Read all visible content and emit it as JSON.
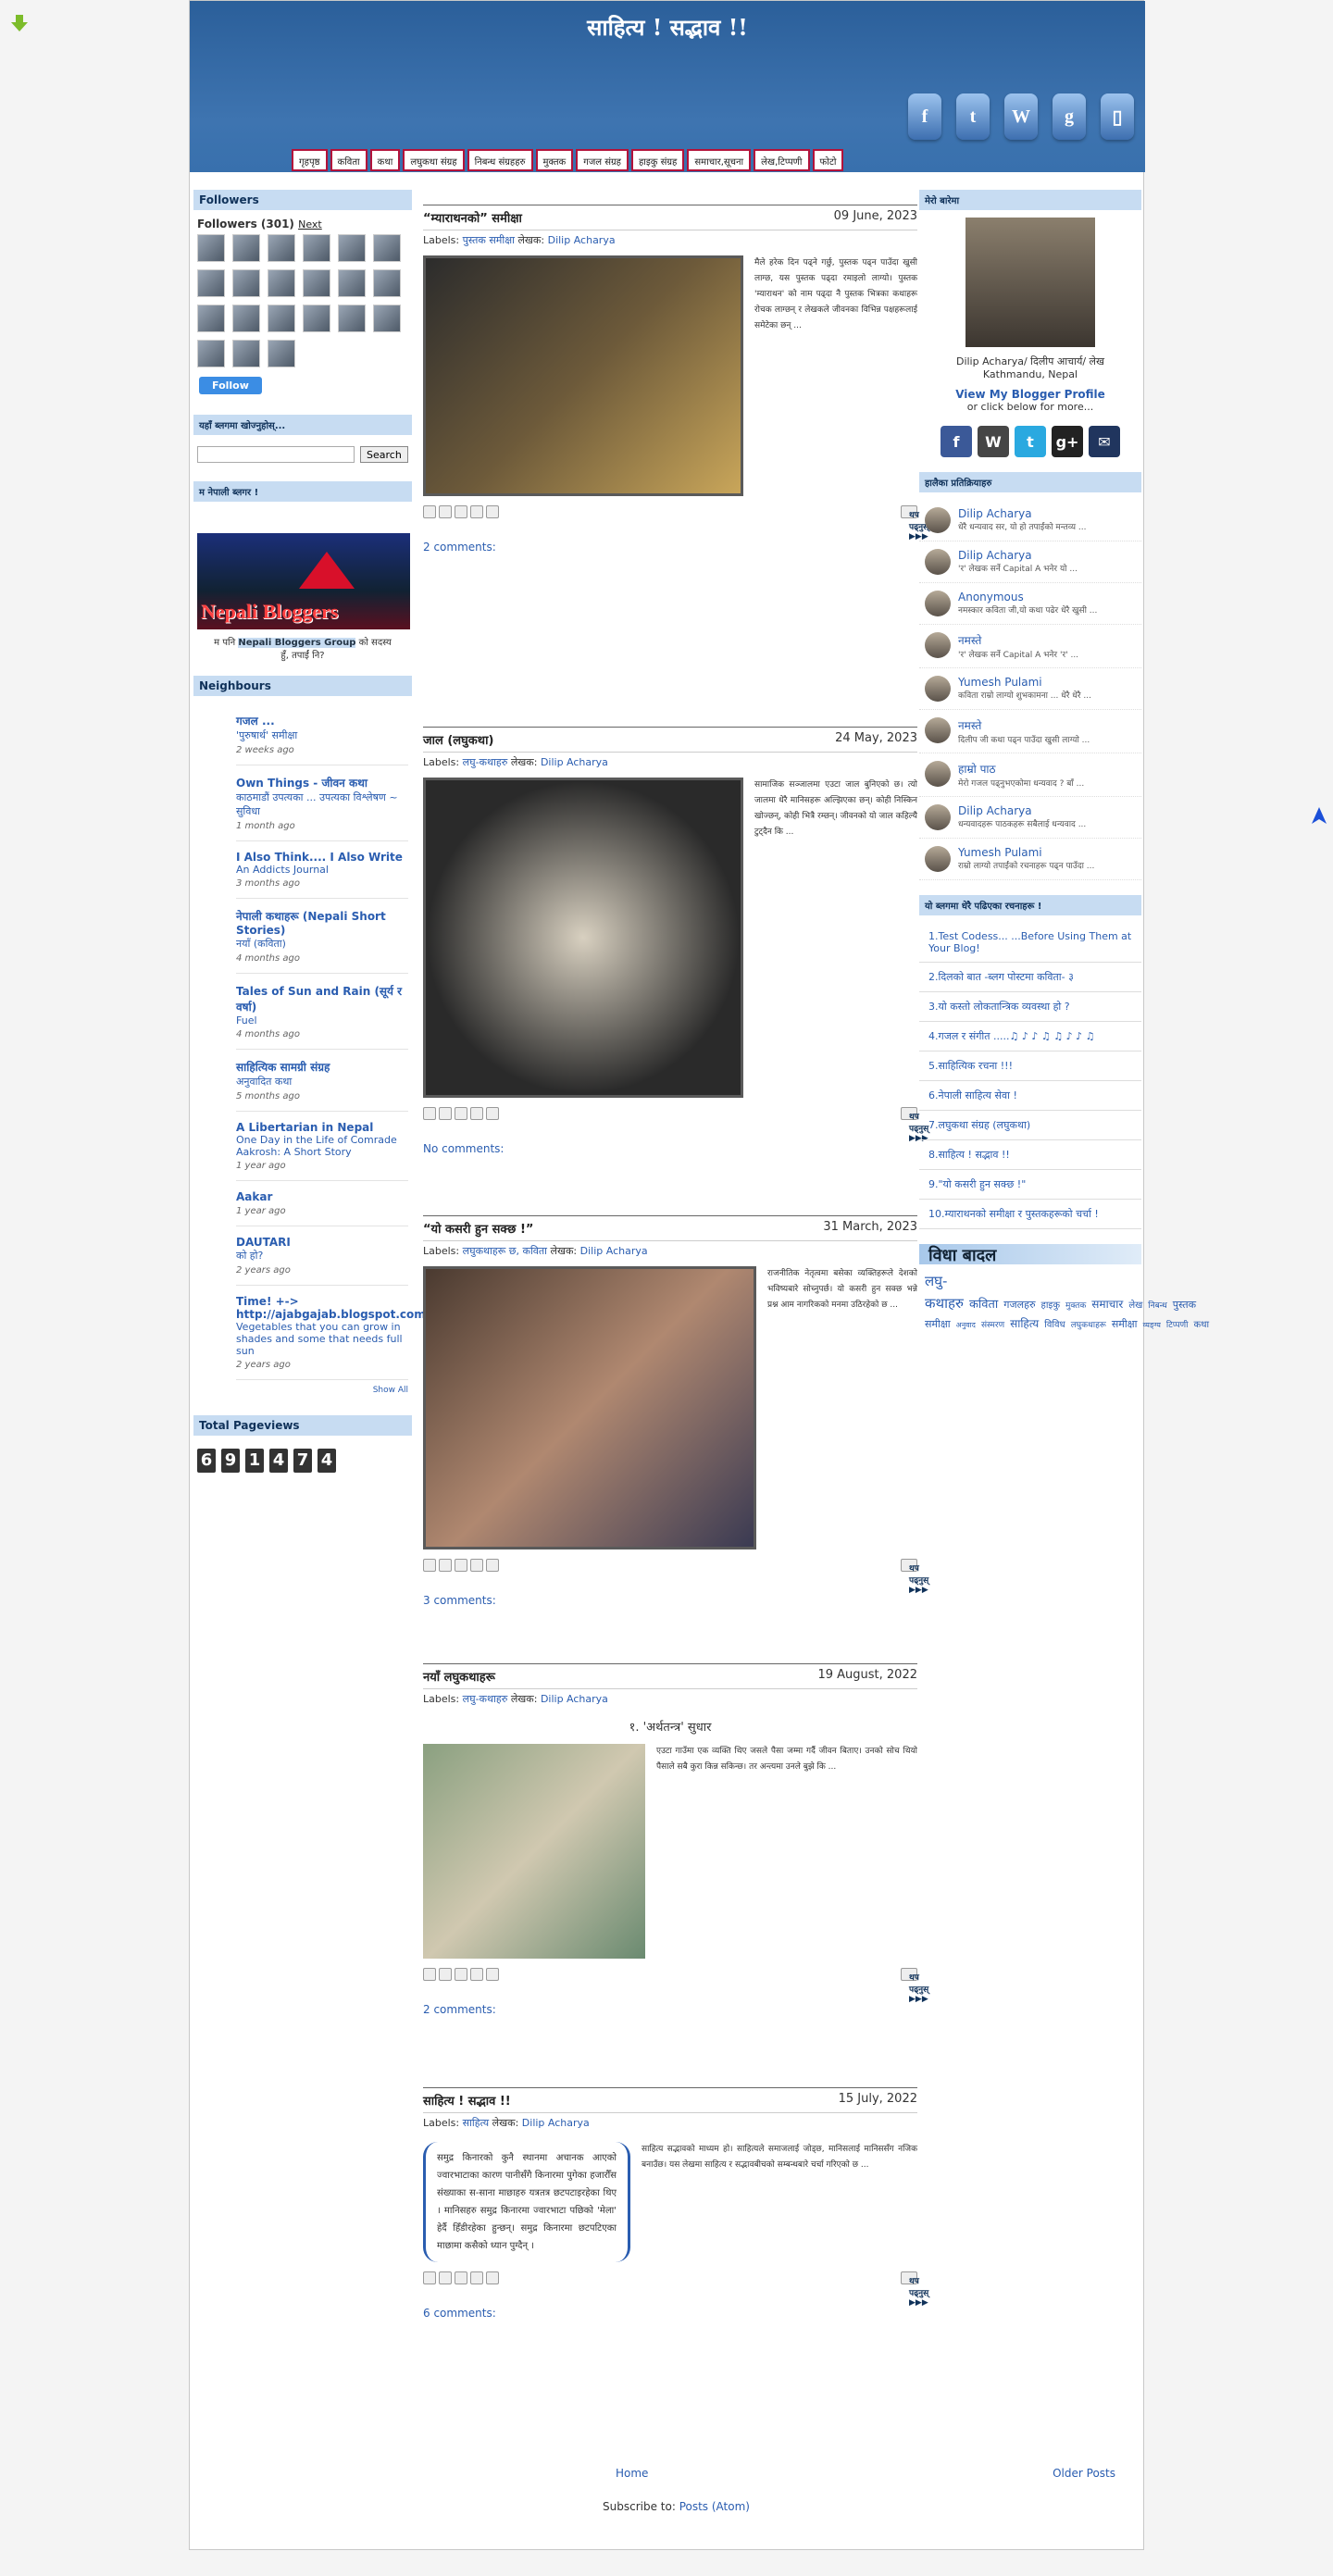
{
  "blog": {
    "title": "साहित्य ! सद्भाव !!"
  },
  "nav": [
    "गृहपृष्ठ",
    "कविता",
    "कथा",
    "लघुकथा संग्रह",
    "निबन्ध संग्रहहरु",
    "मुक्तक",
    "गजल संग्रह",
    "हाइकु संग्रह",
    "समाचार,सूचना",
    "लेख,टिप्पणी",
    "फोटो"
  ],
  "left": {
    "followers_title": "Followers",
    "followers_count": "Followers (301)",
    "followers_next": "Next",
    "follow_label": "Follow",
    "search_title": "यहाँ ब्लगमा खोज्नुहोस्...",
    "search_button": "Search",
    "nb_title": "म नेपाली ब्लगर !",
    "nb_banner_text": "Nepali Bloggers",
    "nb_caption_pre": "म पनि",
    "nb_caption_link": "Nepali Bloggers Group",
    "nb_caption_post": "को सदस्य हुँ, तपाईं नि?",
    "neighbours_title": "Neighbours",
    "neighbours": [
      {
        "title": "गजल ...",
        "sub": "'पुरुषार्थ' समीक्षा",
        "ago": "2 weeks ago"
      },
      {
        "title": "Own Things - जीवन कथा",
        "sub": "काठमाडौं उपत्यका ... उपत्यका विश्लेषण ~ सुविधा",
        "ago": "1 month ago"
      },
      {
        "title": "I Also Think.... I Also Write",
        "sub": "An Addicts Journal",
        "ago": "3 months ago"
      },
      {
        "title": "नेपाली कथाहरू (Nepali Short Stories)",
        "sub": "नयाँ (कविता)",
        "ago": "4 months ago"
      },
      {
        "title": "Tales of Sun and Rain (सूर्य र वर्षा)",
        "sub": "Fuel",
        "ago": "4 months ago"
      },
      {
        "title": "साहित्यिक सामग्री संग्रह",
        "sub": "अनुवादित कथा",
        "ago": "5 months ago"
      },
      {
        "title": "A Libertarian in Nepal",
        "sub": "One Day in the Life of Comrade Aakrosh: A Short Story",
        "ago": "1 year ago"
      },
      {
        "title": "Aakar",
        "sub": "",
        "ago": "1 year ago"
      },
      {
        "title": "DAUTARI",
        "sub": "को हो?",
        "ago": "2 years ago"
      },
      {
        "title": "Time! +-> http://ajabgajab.blogspot.com",
        "sub": "Vegetables that you can grow in shades and some that needs full sun",
        "ago": "2 years ago"
      }
    ],
    "show_all": "Show All",
    "pageviews_title": "Total Pageviews",
    "pageviews_digits": [
      "6",
      "9",
      "1",
      "4",
      "7",
      "4"
    ]
  },
  "posts": [
    {
      "title": "“म्याराथनको” समीक्षा",
      "date": "09 June, 2023",
      "labels_prefix": "Labels:",
      "label": "पुस्तक समीक्षा",
      "author_prefix": "लेखक:",
      "author": "Dilip Acharya",
      "text": "मैले हरेक दिन पढ्ने गर्छु, पुस्तक पढ्न पाउँदा खुसी लाग्छ, यस पुस्तक पढ्दा रमाइलो लाग्यो। पुस्तक 'म्याराथन' को नाम पढ्दा नै पुस्तक भित्रका कथाहरू रोचक लाग्छन् र लेखकले जीवनका विभिन्न पक्षहरूलाई समेटेका छन् ...",
      "more": "थप पढ्नुस् ▶▶▶",
      "comments": "2 comments:"
    },
    {
      "title": "जाल (लघुकथा)",
      "date": "24 May, 2023",
      "labels_prefix": "Labels:",
      "label": "लघु-कथाहरु",
      "author_prefix": "लेखक:",
      "author": "Dilip Acharya",
      "text": "सामाजिक सञ्जालमा एउटा जाल बुनिएको छ। त्यो जालमा धेरै मानिसहरू अल्झिएका छन्। कोही निस्किन खोज्छन्, कोही भित्रै रम्छन्। जीवनको यो जाल कहिल्यै टुट्दैन कि ...",
      "more": "थप पढ्नुस् ▶▶▶",
      "comments": "No comments:"
    },
    {
      "title": "“यो कसरी हुन सक्छ !”",
      "date": "31 March, 2023",
      "labels_prefix": "Labels:",
      "label": "लघुकथाहरू छ, कविता",
      "author_prefix": "लेखक:",
      "author": "Dilip Acharya",
      "text": "राजनीतिक नेतृत्वमा बसेका व्यक्तिहरूले देशको भविष्यबारे सोच्नुपर्छ। यो कसरी हुन सक्छ भन्ने प्रश्न आम नागरिकको मनमा उठिरहेको छ ...",
      "more": "थप पढ्नुस् ▶▶▶",
      "comments": "3 comments:"
    },
    {
      "title": "नयाँ लघुकथाहरू",
      "date": "19 August, 2022",
      "labels_prefix": "Labels:",
      "label": "लघु-कथाहरु",
      "author_prefix": "लेखक:",
      "author": "Dilip Acharya",
      "subtitle": "१. 'अर्थतन्त्र' सुधार",
      "text": "एउटा गाउँमा एक व्यक्ति थिए जसले पैसा जम्मा गर्दै जीवन बिताए। उनको सोच थियो पैसाले सबै कुरा किन्न सकिन्छ। तर अन्त्यमा उनले बुझे कि ...",
      "more": "थप पढ्नुस् ▶▶▶",
      "comments": "2 comments:"
    },
    {
      "title": "साहित्य ! सद्भाव !!",
      "date": "15 July, 2022",
      "labels_prefix": "Labels:",
      "label": "साहित्य",
      "author_prefix": "लेखक:",
      "author": "Dilip Acharya",
      "quote": "समुद्र किनारको कुनै स्थानमा अचानक आएको ज्वारभाटाका कारण पानीसँगै किनारमा पुगेका हजारौँस संख्याका स-साना माछाहरु यत्रतत्र छटपटाइरहेका थिए । मानिसहरु समुद्र किनारमा ज्वारभाटा पछिको 'मेला' हेर्दै हिँडीरहेका हुन्छन्। समुद्र किनारमा छटपटिएका माछामा कसैको ध्यान पुग्दैन् ।",
      "text": "साहित्य सद्भावको माध्यम हो। साहित्यले समाजलाई जोड्छ, मानिसलाई मानिससँग नजिक बनाउँछ। यस लेखमा साहित्य र सद्भावबीचको सम्बन्धबारे चर्चा गरिएको छ ...",
      "more": "थप पढ्नुस् ▶▶▶",
      "comments": "6 comments:"
    }
  ],
  "right": {
    "about_title": "मेरो बारेमा",
    "profile_name": "Dilip Acharya/ दिलीप आचार्य/ लेख",
    "profile_loc": "Kathmandu, Nepal",
    "profile_link": "View My Blogger Profile",
    "profile_sub": "or click below for more...",
    "recent_title": "हालैका प्रतिक्रियाहरु",
    "recent": [
      {
        "name": "Dilip Acharya",
        "text": "धेरै धन्यवाद सर, यो हो तपाईंको मन्तव्य ..."
      },
      {
        "name": "Dilip Acharya",
        "text": "'र' लेखक सर्ने Capital A भनेर यो ..."
      },
      {
        "name": "Anonymous",
        "text": "नमस्कार कविता जी,यो कथा पढेर धेरै खुसी ..."
      },
      {
        "name": "नमस्ते",
        "text": "'र' लेखक सर्ने Capital A भनेर 'र' ..."
      },
      {
        "name": "Yumesh Pulami",
        "text": "कविता राम्रो लाग्यो शुभकामना ... धेरै धेरै ..."
      },
      {
        "name": "नमस्ते",
        "text": "दिलीप जी कथा पढ्न पाउँदा खुसी लाग्यो ..."
      },
      {
        "name": "हाम्रो पाठ",
        "text": "मेरो गजल पढ्नुभएकोमा धन्यवाद ? बाँ ..."
      },
      {
        "name": "Dilip Acharya",
        "text": "धन्यवादहरू पाठकहरू सबैलाई धन्यवाद ..."
      },
      {
        "name": "Yumesh Pulami",
        "text": "राम्रो लाग्यो तपाईंको रचनाहरू पढ्न पाउँदा ..."
      }
    ],
    "popular_title": "यो ब्लगमा धेरै पढिएका रचनाहरू !",
    "popular": [
      "1.Test Codess... ...Before Using Them at Your Blog!",
      "2.दिलको बात -ब्लग पोस्टमा कविता- ३",
      "3.यो कस्तो लोकतान्त्रिक व्यवस्था हो ?",
      "4.गजल र संगीत .....♫ ♪ ♪ ♫ ♫ ♪ ♪ ♫",
      "5.साहित्यिक रचना !!!",
      "6.नेपाली साहित्य सेवा !",
      "7.लघुकथा संग्रह (लघुकथा)",
      "8.साहित्य ! सद्भाव !!",
      "9.\"यो कसरी हुन सक्छ !\"",
      "10.म्याराथनको समीक्षा र पुस्तकहरूको चर्चा !"
    ],
    "cloud_banner": "विधा बादल",
    "cloud": [
      "लघु-कथाहरु",
      "कविता",
      "गजलहरु",
      "हाइकु",
      "मुक्तक",
      "समाचार",
      "लेख",
      "निबन्ध",
      "पुस्तक समीक्षा",
      "अनुवाद",
      "संस्मरण",
      "साहित्य",
      "विविध",
      "लघुकथाहरू",
      "समीक्षा",
      "व्यङ्ग्य",
      "टिप्पणी",
      "कथा"
    ]
  },
  "footer": {
    "home": "Home",
    "older": "Older Posts",
    "subscribe": "Subscribe to:",
    "posts_atom": "Posts (Atom)"
  }
}
